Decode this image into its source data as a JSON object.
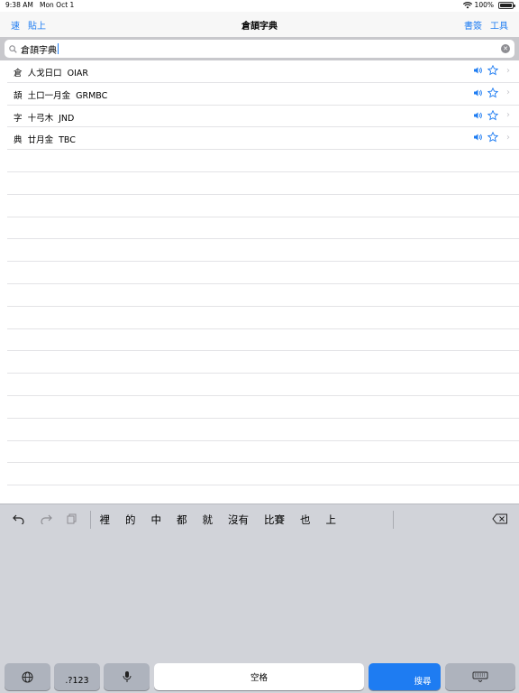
{
  "status": {
    "time": "9:38 AM",
    "date": "Mon Oct 1",
    "battery": "100%"
  },
  "nav": {
    "left": [
      "速",
      "貼上"
    ],
    "title": "倉頡字典",
    "right": [
      "書簽",
      "工具"
    ]
  },
  "search": {
    "value": "倉頡字典",
    "clear_icon": "clear-icon"
  },
  "rows": [
    {
      "char": "倉",
      "parts": "人戈日口",
      "code": "OIAR"
    },
    {
      "char": "頡",
      "parts": "土口一月金",
      "code": "GRMBC"
    },
    {
      "char": "字",
      "parts": "十弓木",
      "code": "JND"
    },
    {
      "char": "典",
      "parts": "廿月金",
      "code": "TBC"
    }
  ],
  "predictions": [
    "裡",
    "的",
    "中",
    "都",
    "就",
    "沒有",
    "比賽",
    "也",
    "上"
  ],
  "keyboard": {
    "numbers": ".?123",
    "space": "空格",
    "search": "搜尋"
  },
  "colors": {
    "accent": "#1e7cf2",
    "separator": "#e3e3e6"
  }
}
